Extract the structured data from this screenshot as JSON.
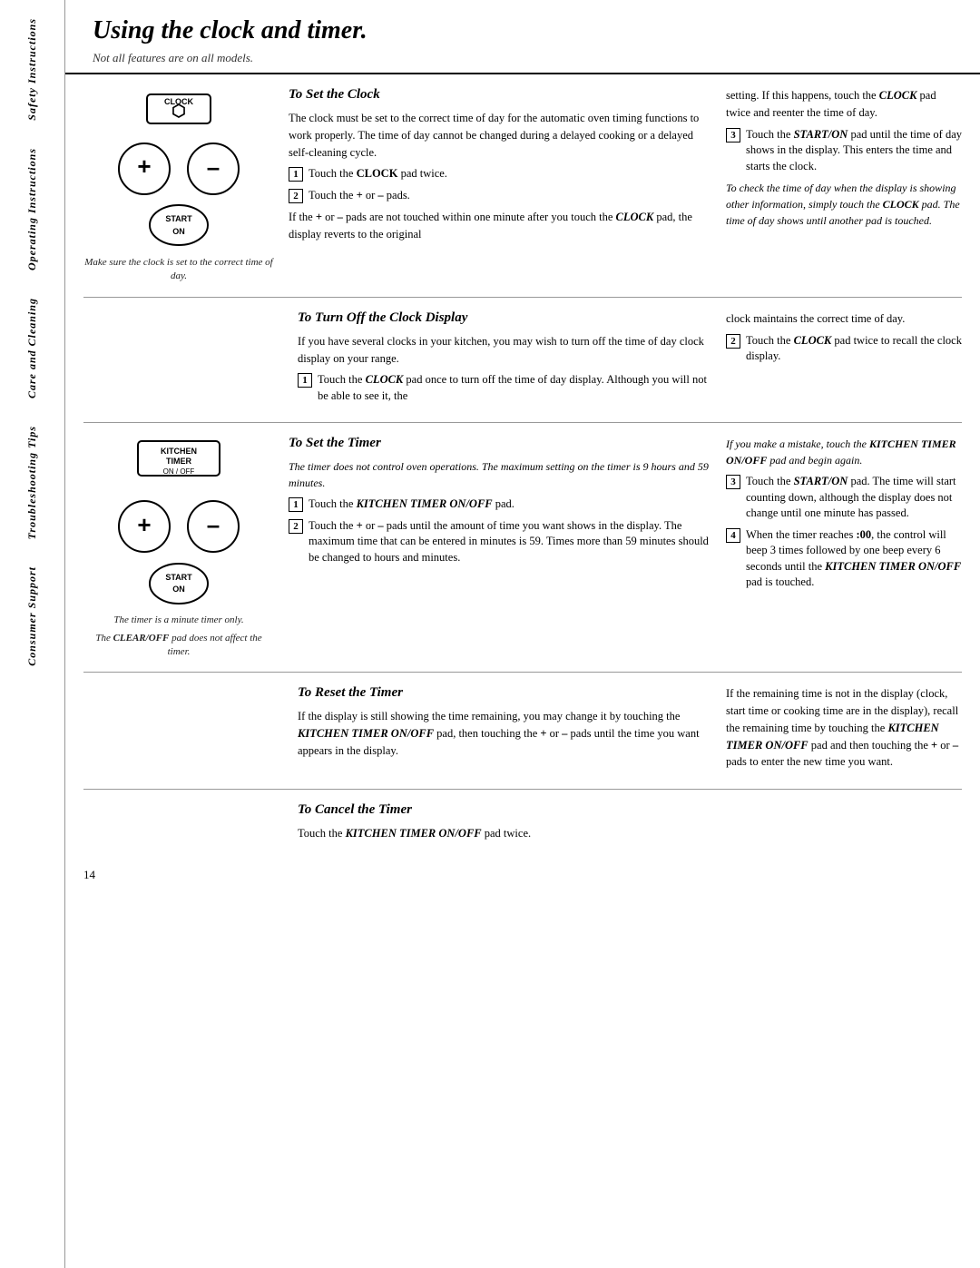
{
  "sidebar": {
    "labels": [
      "Safety Instructions",
      "Operating Instructions",
      "Care and Cleaning",
      "Troubleshooting Tips",
      "Consumer Support"
    ]
  },
  "title": "Using the clock and timer.",
  "subtitle": "Not all features are on all models.",
  "sections": {
    "set_clock": {
      "title": "To Set the Clock",
      "body": "The clock must be set to the correct time of day for the automatic oven timing functions to work properly. The time of day cannot be changed during a delayed cooking or a delayed self-cleaning cycle.",
      "right_body": "setting. If this happens, touch the CLOCK pad twice and reenter the time of day.",
      "steps": [
        "Touch the CLOCK pad twice.",
        "Touch the + or – pads."
      ],
      "if_text": "If the + or – pads are not touched within one minute after you touch the CLOCK pad, the display reverts to the original",
      "step3": "Touch the START/ON pad until the time of day shows in the display. This enters the time and starts the clock.",
      "italic_note": "To check the time of day when the display is showing other information, simply touch the CLOCK pad. The time of day shows until another pad is touched.",
      "caption1": "Make sure the clock is set to the correct time of day."
    },
    "turn_off_display": {
      "title": "To Turn Off the Clock Display",
      "body": "If you have several clocks in your kitchen, you may wish to turn off the time of day clock display on your range.",
      "right_body": "clock maintains the correct time of day.",
      "step1": "Touch the CLOCK pad once to turn off the time of day display. Although you will not be able to see it, the",
      "step2": "Touch the CLOCK pad twice to recall the clock display."
    },
    "set_timer": {
      "title": "To Set the Timer",
      "italic1": "The timer does not control oven operations. The maximum setting on the timer is 9 hours and 59 minutes.",
      "right_italic": "If you make a mistake, touch the KITCHEN TIMER ON/OFF pad and begin again.",
      "step1": "Touch the KITCHEN TIMER ON/OFF pad.",
      "step2": "Touch the + or – pads until the amount of time you want shows in the display. The maximum time that can be entered in minutes is 59. Times more than 59 minutes should be changed to hours and minutes.",
      "step3": "Touch the START/ON pad. The time will start counting down, although the display does not change until one minute has passed.",
      "step4": "When the timer reaches :00, the control will beep 3 times followed by one beep every 6 seconds until the KITCHEN TIMER ON/OFF pad is touched.",
      "caption1": "The timer is a minute timer only.",
      "caption2": "The CLEAR/OFF pad does not affect the timer."
    },
    "reset_timer": {
      "title": "To Reset the Timer",
      "body": "If the display is still showing the time remaining, you may change it by touching the KITCHEN TIMER ON/OFF pad, then touching the + or – pads until the time you want appears in the display.",
      "right_body": "If the remaining time is not in the display (clock, start time or cooking time are in the display), recall the remaining time by touching the KITCHEN TIMER ON/OFF pad and then touching the + or – pads to enter the new time you want."
    },
    "cancel_timer": {
      "title": "To Cancel the Timer",
      "body": "Touch the KITCHEN TIMER ON/OFF pad twice."
    }
  },
  "page_number": "14"
}
